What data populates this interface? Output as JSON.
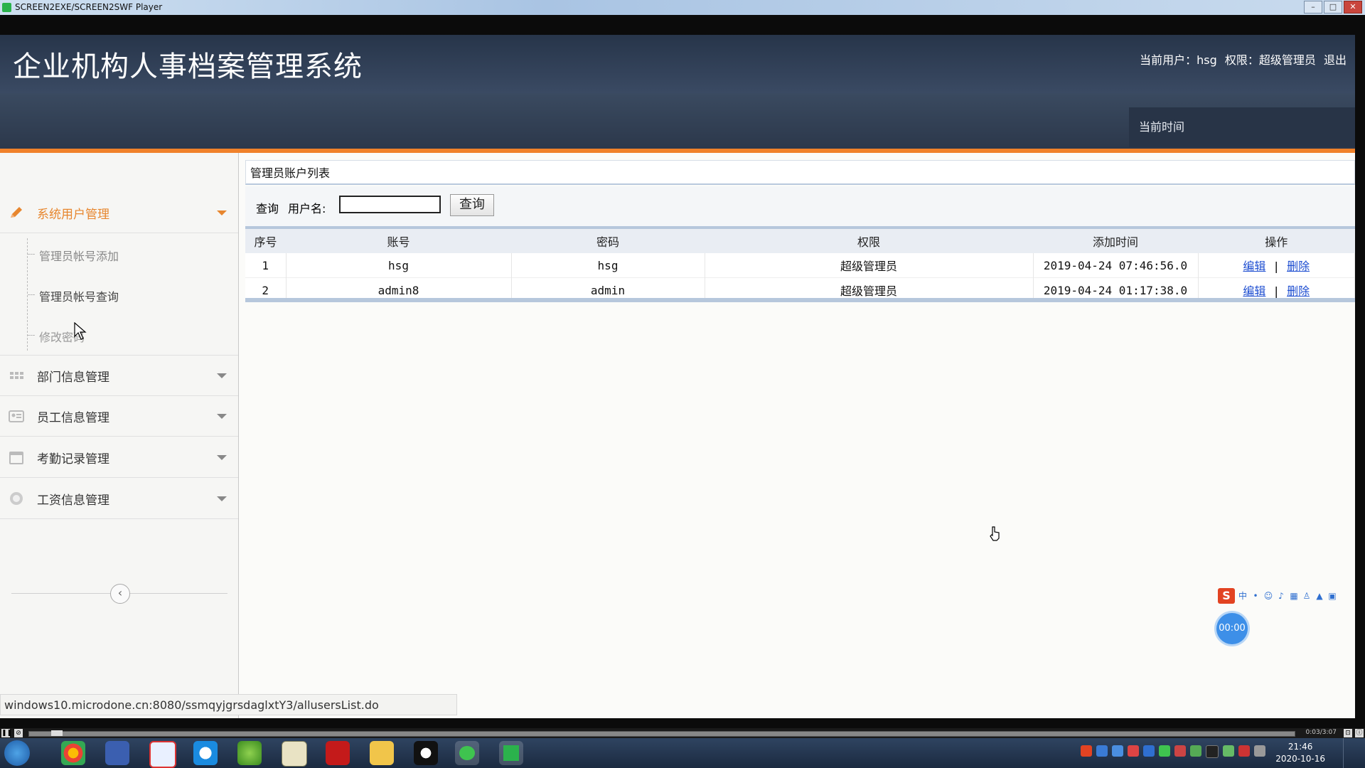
{
  "window": {
    "title": "SCREEN2EXE/SCREEN2SWF Player",
    "buttons": [
      "–",
      "□",
      "✕"
    ]
  },
  "header": {
    "system_title": "企业机构人事档案管理系统",
    "current_user_label": "当前用户：",
    "current_user": "hsg",
    "role_label": "权限：",
    "role": "超级管理员",
    "logout": "退出",
    "time_label": "当前时间"
  },
  "sidebar": {
    "groups": [
      {
        "label": "系统用户管理",
        "icon": "pencil-icon",
        "active": true
      },
      {
        "label": "部门信息管理",
        "icon": "grid-icon"
      },
      {
        "label": "员工信息管理",
        "icon": "id-card-icon"
      },
      {
        "label": "考勤记录管理",
        "icon": "calendar-icon"
      },
      {
        "label": "工资信息管理",
        "icon": "coin-icon"
      }
    ],
    "subitems": [
      "管理员帐号添加",
      "管理员帐号查询",
      "修改密码"
    ],
    "collapse_symbol": "‹"
  },
  "main": {
    "panel_title": "管理员账户列表",
    "search": {
      "query_label": "查询",
      "username_label": "用户名:",
      "username_value": "",
      "button_label": "查询"
    },
    "table": {
      "columns": [
        "序号",
        "账号",
        "密码",
        "权限",
        "添加时间",
        "操作"
      ],
      "rows": [
        {
          "no": "1",
          "account": "hsg",
          "password": "hsg",
          "role": "超级管理员",
          "added": "2019-04-24 07:46:56.0",
          "edit": "编辑",
          "delete": "删除"
        },
        {
          "no": "2",
          "account": "admin8",
          "password": "admin",
          "role": "超级管理员",
          "added": "2019-04-24 01:17:38.0",
          "edit": "编辑",
          "delete": "删除"
        }
      ],
      "op_separator": "|"
    }
  },
  "status_url": "windows10.microdone.cn:8080/ssmqyjgrsdaglxtY3/allusersList.do",
  "overlay": {
    "ime_logo": "S",
    "ime_mode": "中",
    "timer": "00:00"
  },
  "player": {
    "time": "0:03/3:07"
  },
  "taskbar": {
    "time": "21:46",
    "date": "2020-10-16"
  },
  "colors": {
    "accent_orange": "#f0812a",
    "header_dark": "#2c384b",
    "link_blue": "#1f4fd1"
  }
}
